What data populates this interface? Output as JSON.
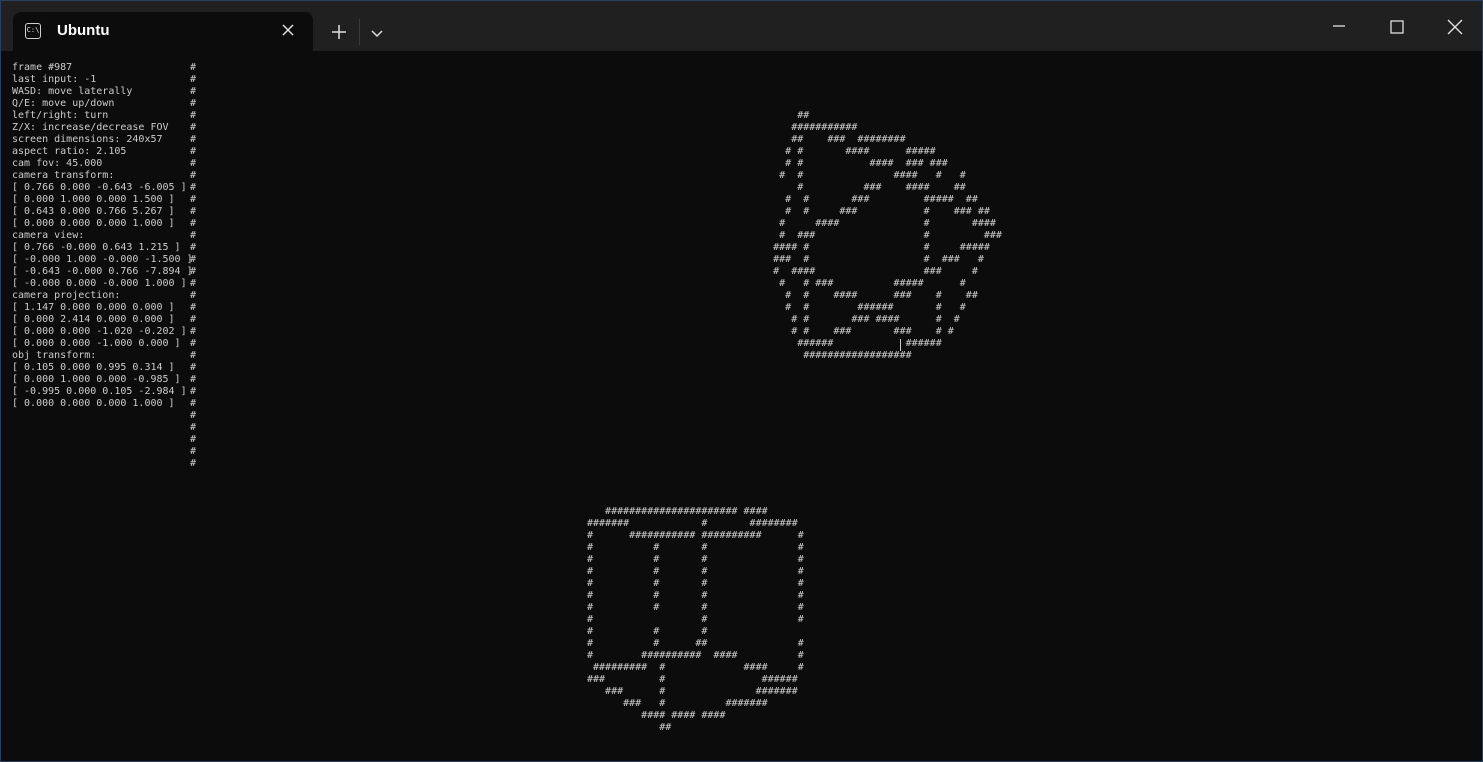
{
  "window": {
    "tab_title": "Ubuntu",
    "tab_icon": "terminal-icon",
    "buttons": [
      "new-tab",
      "dropdown",
      "minimize",
      "maximize",
      "close"
    ]
  },
  "terminal": {
    "hud_lines": "frame #987\nlast input: -1\nWASD: move laterally\nQ/E: move up/down\nleft/right: turn\nZ/X: increase/decrease FOV\nscreen dimensions: 240x57\naspect ratio: 2.105\ncam fov: 45.000\ncamera transform:\n[ 0.766 0.000 -0.643 -6.005 ]\n[ 0.000 1.000 0.000 1.500 ]\n[ 0.643 0.000 0.766 5.267 ]\n[ 0.000 0.000 0.000 1.000 ]\ncamera view:\n[ 0.766 -0.000 0.643 1.215 ]\n[ -0.000 1.000 -0.000 -1.500 ]\n[ -0.643 -0.000 0.766 -7.894 ]\n[ -0.000 0.000 -0.000 1.000 ]\ncamera projection:\n[ 1.147 0.000 0.000 0.000 ]\n[ 0.000 2.414 0.000 0.000 ]\n[ 0.000 0.000 -1.020 -0.202 ]\n[ 0.000 0.000 -1.000 0.000 ]\nobj transform:\n[ 0.105 0.000 0.995 0.314 ]\n[ 0.000 1.000 0.000 -0.985 ]\n[ -0.995 0.000 0.105 -2.984 ]\n[ 0.000 0.000 0.000 1.000 ]",
    "hud_border": "#\n#\n#\n#\n#\n#\n#\n#\n#\n#\n#\n#\n#\n#\n#\n#\n#\n#\n#\n#\n#\n#\n#\n#\n#\n#\n#\n#\n#\n#\n#\n#\n#\n#",
    "object_1": "           ##\n          ###########\n          ##    ###  ########\n         # #       ####      #####\n         # #           ####  ### ###\n        #  #               ####   #   #\n           #          ###    ####    ##\n         #  #       ###         #####  ##\n         #  #     ###           #    ### ##\n        #     ####              #       ####\n        #  ###                  #         ###\n       #### #                   #     #####\n       ###  #                   #  ###   #\n       #  ####                  ###     #\n        #   # ###          #####      #\n         #  #    ####      ###    #    ##\n         #  #        ######       #   #\n          # #       ### ####      #  #\n          # #    ###       ###    # #\n           ######            ######\n            ##################",
    "object_2": "   ###################### ####\n#######            #       ########\n#      ########### ##########      #\n#          #       #               #\n#          #       #               #\n#          #       #               #\n#          #       #               #\n#          #       #               #\n#          #       #               #\n#                  #               #\n#          #       #\n#          #      ##               #\n#        ##########  ####          #\n #########  #             ####     #\n###         #                ######\n   ###      #               #######\n      ###   #          #######\n         #### #### ####\n            ##"
  }
}
